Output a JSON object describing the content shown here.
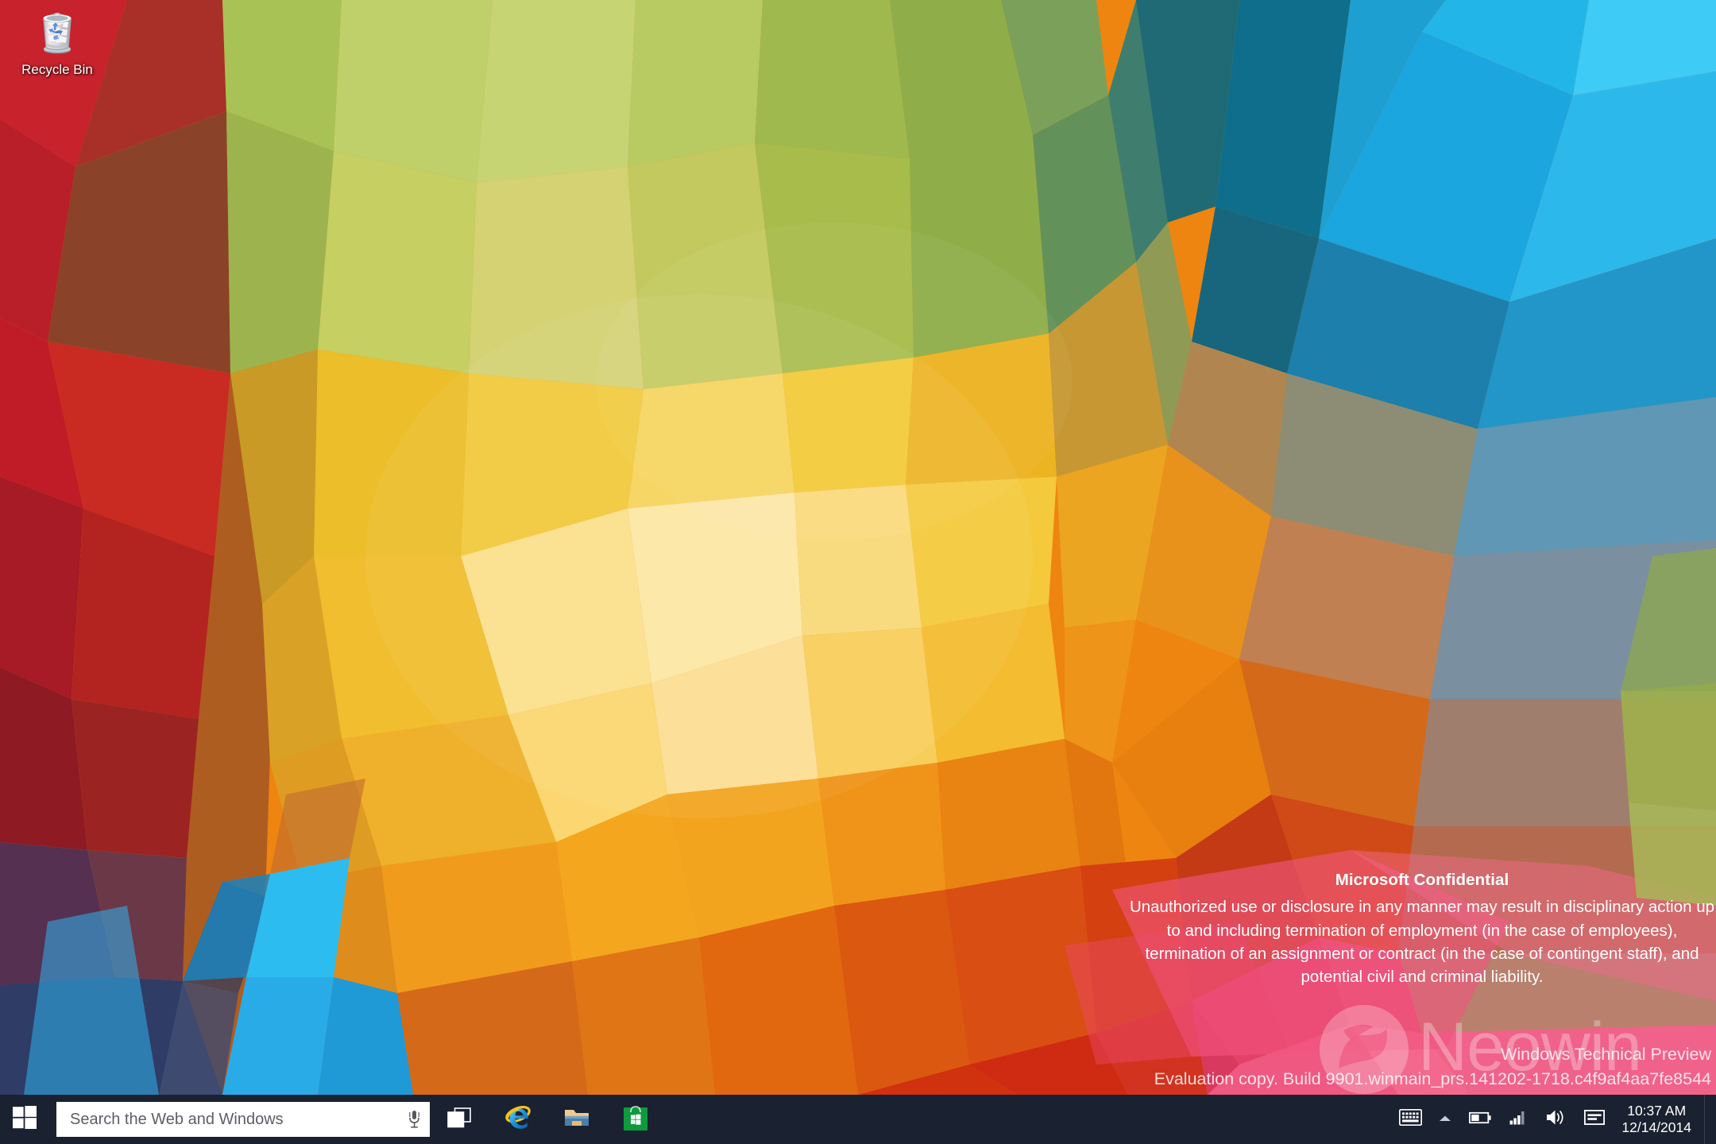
{
  "desktop": {
    "icons": [
      {
        "label": "Recycle Bin",
        "icon": "recycle-bin-icon"
      }
    ]
  },
  "confidential_notice": {
    "title": "Microsoft Confidential",
    "body": "Unauthorized use or disclosure in any manner may result in disciplinary action up to and including termination of employment (in the case of employees), termination of an assignment or contract (in the case of contingent staff), and potential civil and criminal liability."
  },
  "watermark": {
    "site": "Neowin",
    "product_line": "Windows Technical Preview",
    "build_line": "Evaluation copy. Build 9901.winmain_prs.141202-1718.c4f9af4aa7fe8544"
  },
  "taskbar": {
    "start_button": {
      "name": "Start",
      "icon": "windows-logo-icon"
    },
    "search": {
      "placeholder": "Search the Web and Windows",
      "value": "",
      "mic_icon": "microphone-icon"
    },
    "apps": [
      {
        "name": "Task View",
        "icon": "task-view-icon"
      },
      {
        "name": "Internet Explorer",
        "icon": "internet-explorer-icon"
      },
      {
        "name": "File Explorer",
        "icon": "file-explorer-icon"
      },
      {
        "name": "Store",
        "icon": "store-icon"
      }
    ],
    "tray": [
      {
        "name": "Touch Keyboard",
        "icon": "keyboard-icon"
      },
      {
        "name": "Show hidden icons",
        "icon": "chevron-up-icon"
      },
      {
        "name": "Battery",
        "icon": "battery-icon"
      },
      {
        "name": "Network",
        "icon": "signal-bars-icon"
      },
      {
        "name": "Volume",
        "icon": "speaker-icon"
      },
      {
        "name": "Action Center",
        "icon": "action-center-icon"
      }
    ],
    "clock": {
      "time": "10:37 AM",
      "date": "12/14/2014"
    },
    "background_color": "#1a2130",
    "search_background": "#ffffff",
    "text_color": "#ffffff"
  },
  "colors": {
    "taskbar": "#1a2130",
    "search_field": "#ffffff",
    "search_placeholder": "#5a5f66",
    "accent_orange": "#F59A1E",
    "accent_red": "#D8232A",
    "accent_blue": "#17A8E8",
    "accent_green": "#9DBE3C",
    "accent_pink": "#F0557E"
  }
}
